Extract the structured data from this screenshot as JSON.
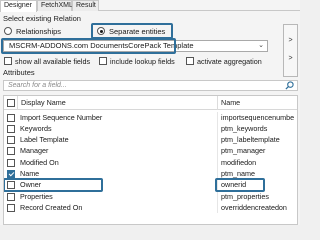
{
  "tabs": [
    {
      "label": "Designer",
      "active": true
    },
    {
      "label": "FetchXML",
      "active": false
    },
    {
      "label": "Result",
      "active": false
    }
  ],
  "relation": {
    "title": "Select existing Relation",
    "option_relationships": "Relationships",
    "option_separate": "Separate entities",
    "selected": "Separate entities",
    "template_value": "MSCRM-ADDONS.com DocumentsCorePack Template"
  },
  "side_buttons": {
    "top": ">",
    "bottom": ">"
  },
  "filters": {
    "show_all": "show all available fields",
    "include_lookup": "include lookup fields",
    "activate_aggregation": "activate aggregation"
  },
  "attributes": {
    "title": "Attributes",
    "search_placeholder": "Search for a field..."
  },
  "grid": {
    "columns": [
      "Display Name",
      "Name"
    ],
    "rows": [
      {
        "display": "Import Sequence Number",
        "name": "importsequencenumbe",
        "checked": false
      },
      {
        "display": "Keywords",
        "name": "ptm_keywords",
        "checked": false
      },
      {
        "display": "Label Template",
        "name": "ptm_labeltemplate",
        "checked": false
      },
      {
        "display": "Manager",
        "name": "ptm_manager",
        "checked": false
      },
      {
        "display": "Modified On",
        "name": "modifiedon",
        "checked": false
      },
      {
        "display": "Name",
        "name": "ptm_name",
        "checked": true
      },
      {
        "display": "Owner",
        "name": "ownerid",
        "checked": false
      },
      {
        "display": "Properties",
        "name": "ptm_properties",
        "checked": false
      },
      {
        "display": "Record Created On",
        "name": "overriddencreatedon",
        "checked": false
      }
    ]
  },
  "colors": {
    "highlight": "#2f6f9a"
  }
}
